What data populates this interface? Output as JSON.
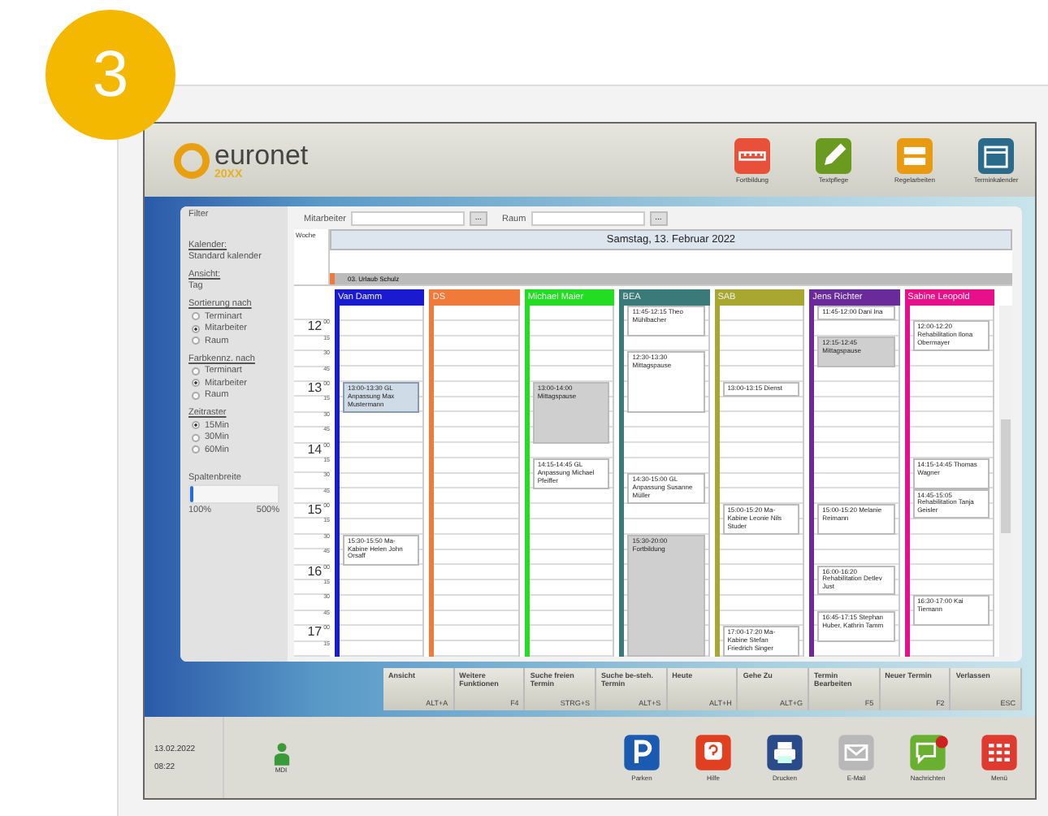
{
  "badge": "3",
  "logo": {
    "name": "euronet",
    "edition": "20XX"
  },
  "toolbar": [
    {
      "label": "Fortbildung",
      "kind": "ruler"
    },
    {
      "label": "Textpflege",
      "kind": "pencil"
    },
    {
      "label": "Regelarbeiten",
      "kind": "form"
    },
    {
      "label": "Terminkalender",
      "kind": "calendar"
    }
  ],
  "filters": [
    {
      "label": "Mitarbeiter",
      "button": "..."
    },
    {
      "label": "Raum",
      "button": "..."
    }
  ],
  "filter_panel": {
    "title": "Filter",
    "calendar_label": "Kalender:",
    "calendar_value": "Standard kalender",
    "view_label": "Ansicht:",
    "view_value": "Tag",
    "groups": [
      {
        "title": "Sortierung nach",
        "options": [
          {
            "label": "Terminart",
            "selected": false
          },
          {
            "label": "Mitarbeiter",
            "selected": true
          },
          {
            "label": "Raum",
            "selected": false
          }
        ]
      },
      {
        "title": "Farbkennz. nach",
        "options": [
          {
            "label": "Terminart",
            "selected": false
          },
          {
            "label": "Mitarbeiter",
            "selected": true
          },
          {
            "label": "Raum",
            "selected": false
          }
        ]
      },
      {
        "title": "Zeitraster",
        "options": [
          {
            "label": "15Min",
            "selected": true
          },
          {
            "label": "30Min",
            "selected": false
          },
          {
            "label": "60Min",
            "selected": false
          }
        ]
      }
    ],
    "column_width": {
      "label": "Spaltenbreite",
      "level": 0.04,
      "min": "100%",
      "max": "500%"
    }
  },
  "week_label": "Woche",
  "date": "Samstag, 13. Februar 2022",
  "all_day": "03. Urlaub Schulz",
  "time_rows": [
    {
      "hour": "12",
      "minute": "00"
    },
    {
      "minute": "15"
    },
    {
      "minute": "30"
    },
    {
      "minute": "45"
    },
    {
      "hour": "13",
      "minute": "00"
    },
    {
      "minute": "15"
    },
    {
      "minute": "30"
    },
    {
      "minute": "45"
    },
    {
      "hour": "14",
      "minute": "00"
    },
    {
      "minute": "15"
    },
    {
      "minute": "30"
    },
    {
      "minute": "45"
    },
    {
      "hour": "15",
      "minute": "00"
    },
    {
      "minute": "15"
    },
    {
      "minute": "30"
    },
    {
      "minute": "45"
    },
    {
      "hour": "16",
      "minute": "00"
    },
    {
      "minute": "15"
    },
    {
      "minute": "30"
    },
    {
      "minute": "45"
    },
    {
      "hour": "17",
      "minute": "00"
    },
    {
      "minute": "15"
    }
  ],
  "columns": [
    {
      "name": "Van Damm",
      "color": "#1a1ad0",
      "appointments": [
        {
          "time": "13:00-13:30",
          "text": "GL Anpassung Max Mustermann",
          "kind": "highlight"
        },
        {
          "time": "15:30-15:50",
          "text": "Ma-Kabine Helen John Orsaff",
          "kind": "plain"
        }
      ]
    },
    {
      "name": "DS",
      "color": "#f07a3a"
    },
    {
      "name": "Michael Maier",
      "color": "#22dd22",
      "appointments": [
        {
          "time": "13:00-14:00",
          "text": "Mittagspause",
          "kind": "shaded"
        },
        {
          "time": "14:15-14:45",
          "text": "GL Anpassung Michael Pfeiffer",
          "kind": "plain"
        }
      ]
    },
    {
      "name": "BEA",
      "color": "#3a7a78",
      "appointments": [
        {
          "time": "11:45-12:15",
          "text": "Theo Mühlbacher",
          "kind": "plain"
        },
        {
          "time": "12:30-13:30",
          "text": "Mittagspause",
          "kind": "plain"
        },
        {
          "time": "14:30-15:00",
          "text": "GL Anpassung Susanne Müller",
          "kind": "plain"
        },
        {
          "time": "15:30-20:00",
          "text": "Fortbildung",
          "kind": "shaded"
        }
      ]
    },
    {
      "name": "SAB",
      "color": "#a8a830",
      "appointments": [
        {
          "time": "13:00-13:15",
          "text": "Dienst",
          "kind": "plain"
        },
        {
          "time": "15:00-15:20",
          "text": "Ma-Kabine Leonie Nils Studer",
          "kind": "plain"
        },
        {
          "time": "17:00-17:20",
          "text": "Ma-Kabine Stefan Friedrich Singer",
          "kind": "plain"
        }
      ]
    },
    {
      "name": "Jens Richter",
      "color": "#6a2a9a",
      "appointments": [
        {
          "time": "11:45-12:00",
          "text": "Dani Ina",
          "kind": "plain"
        },
        {
          "time": "12:15-12:45",
          "text": "Mittagspause",
          "kind": "shaded"
        },
        {
          "time": "15:00-15:20",
          "text": "Melanie Reimann",
          "kind": "plain"
        },
        {
          "time": "16:00-16:20",
          "text": "Rehabilitation Detlev Just",
          "kind": "plain"
        },
        {
          "time": "16:45-17:15",
          "text": "Stephan Huber, Kathrin Tamm",
          "kind": "plain"
        }
      ]
    },
    {
      "name": "Sabine Leopold",
      "color": "#e8108a",
      "appointments": [
        {
          "time": "12:00-12:20",
          "text": "Rehabilitation Ilona Obermayer",
          "kind": "plain"
        },
        {
          "time": "14:15-14:45",
          "text": "Thomas Wagner",
          "kind": "plain"
        },
        {
          "time": "14:45-15:05",
          "text": "Rehabilitation Tanja Geisler",
          "kind": "plain"
        },
        {
          "time": "16:30-17:00",
          "text": "Kai Tiemann",
          "kind": "plain"
        }
      ]
    }
  ],
  "function_keys": [
    {
      "label": "Ansicht",
      "shortcut": "ALT+A"
    },
    {
      "label": "Weitere Funktionen",
      "shortcut": "F4"
    },
    {
      "label": "Suche freien Termin",
      "shortcut": "STRG+S"
    },
    {
      "label": "Suche be-steh. Termin",
      "shortcut": "ALT+S"
    },
    {
      "label": "Heute",
      "shortcut": "ALT+H"
    },
    {
      "label": "Gehe Zu",
      "shortcut": "ALT+G"
    },
    {
      "label": "Termin Bearbeiten",
      "shortcut": "F5"
    },
    {
      "label": "Neuer Termin",
      "shortcut": "F2"
    },
    {
      "label": "Verlassen",
      "shortcut": "ESC"
    }
  ],
  "status": {
    "date": "13.02.2022",
    "time": "08:22",
    "user": "MDI"
  },
  "dock": [
    {
      "label": "Parken",
      "kind": "park"
    },
    {
      "label": "Hilfe",
      "kind": "help"
    },
    {
      "label": "Drucken",
      "kind": "print"
    },
    {
      "label": "E-Mail",
      "kind": "mail"
    },
    {
      "label": "Nachrichten",
      "kind": "message"
    },
    {
      "label": "Menü",
      "kind": "menu"
    }
  ]
}
